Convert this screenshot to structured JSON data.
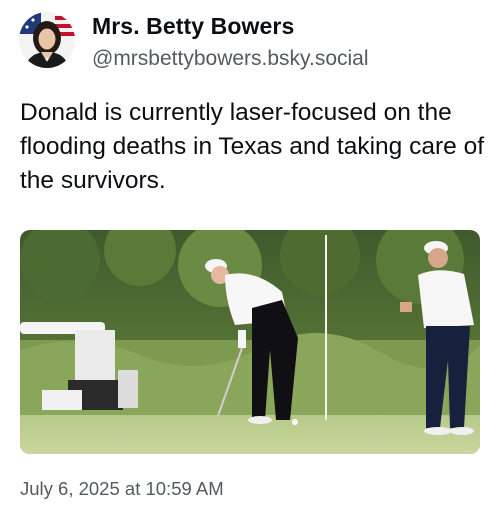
{
  "author": {
    "display_name": "Mrs. Betty Bowers",
    "handle": "@mrsbettybowers.bsky.social",
    "avatar_icon": "profile-photo-avatar"
  },
  "post": {
    "text": "Donald is currently laser-focused on the flooding deaths in Texas and taking care of the survivors.",
    "timestamp": "July 6, 2025 at 10:59 AM"
  },
  "media": {
    "description_icon": "golf-course-photo"
  },
  "colors": {
    "text_primary": "#0b0f14",
    "text_secondary": "#555a61",
    "background": "#ffffff"
  }
}
